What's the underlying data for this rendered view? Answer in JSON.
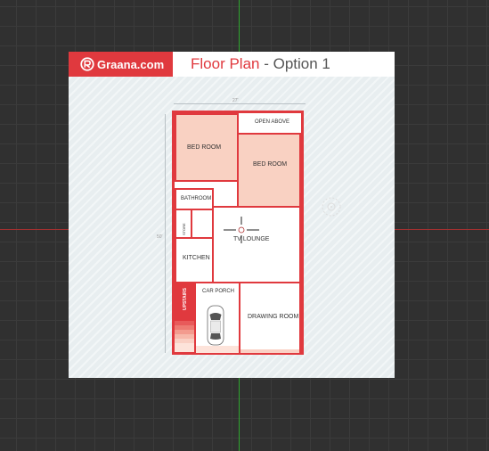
{
  "brand": {
    "name": "Graana.com"
  },
  "header": {
    "title_accent": "Floor Plan",
    "title_rest": " - Option 1"
  },
  "dimensions": {
    "width_label": "27'",
    "depth_label": "50'"
  },
  "rooms": {
    "bed_room_1": "BED ROOM",
    "open_above": "OPEN ABOVE",
    "bed_room_2": "BED ROOM",
    "bathroom": "BATHROOM",
    "store": "STORE",
    "tv_lounge": "TV LOUNGE",
    "kitchen": "KITCHEN",
    "upstairs": "UPSTAIRS",
    "car_porch": "CAR PORCH",
    "drawing_room": "DRAWING ROOM"
  },
  "colors": {
    "accent": "#e0393e",
    "room_fill": "#f9d1c2",
    "axis_x": "#a33030",
    "axis_y": "#2fa52f"
  }
}
